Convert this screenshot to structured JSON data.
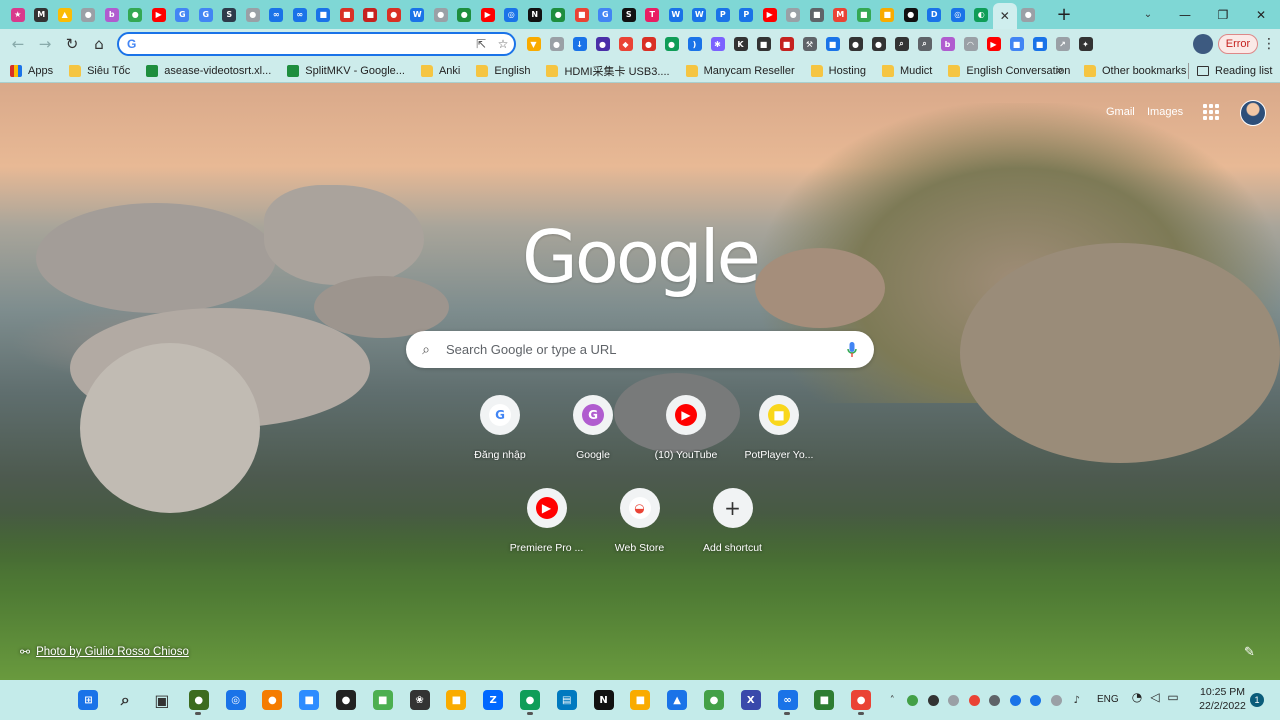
{
  "tabstrip": {
    "tabs": [
      {
        "icon": "ext-icon",
        "color": "#d93a8c",
        "glyph": "★"
      },
      {
        "icon": "site-icon",
        "color": "#333333",
        "glyph": "M"
      },
      {
        "icon": "drive-icon",
        "color": "#fbbc04",
        "glyph": "▲"
      },
      {
        "icon": "site-icon",
        "color": "#9aa0a6",
        "glyph": "●"
      },
      {
        "icon": "site-icon",
        "color": "#b05ccf",
        "glyph": "b"
      },
      {
        "icon": "site-icon",
        "color": "#34a853",
        "glyph": "●"
      },
      {
        "icon": "youtube-icon",
        "color": "#ff0000",
        "glyph": "▶"
      },
      {
        "icon": "google-icon",
        "color": "#4285f4",
        "glyph": "G"
      },
      {
        "icon": "google-icon",
        "color": "#4285f4",
        "glyph": "G"
      },
      {
        "icon": "site-icon",
        "color": "#2e3a4a",
        "glyph": "S"
      },
      {
        "icon": "site-icon",
        "color": "#9aa0a6",
        "glyph": "●"
      },
      {
        "icon": "site-icon",
        "color": "#1a73e8",
        "glyph": "∞"
      },
      {
        "icon": "site-icon",
        "color": "#1a73e8",
        "glyph": "∞"
      },
      {
        "icon": "site-icon",
        "color": "#1a73e8",
        "glyph": "■"
      },
      {
        "icon": "site-icon",
        "color": "#d93025",
        "glyph": "■"
      },
      {
        "icon": "site-icon",
        "color": "#c5221f",
        "glyph": "■"
      },
      {
        "icon": "site-icon",
        "color": "#d93025",
        "glyph": "●"
      },
      {
        "icon": "wordpress-icon",
        "color": "#1a73e8",
        "glyph": "W"
      },
      {
        "icon": "site-icon",
        "color": "#9aa0a6",
        "glyph": "●"
      },
      {
        "icon": "site-icon",
        "color": "#1e8e3e",
        "glyph": "●"
      },
      {
        "icon": "youtube-icon",
        "color": "#ff0000",
        "glyph": "▶"
      },
      {
        "icon": "site-icon",
        "color": "#1a73e8",
        "glyph": "◎"
      },
      {
        "icon": "notion-icon",
        "color": "#111111",
        "glyph": "N"
      },
      {
        "icon": "site-icon",
        "color": "#1e8e3e",
        "glyph": "●"
      },
      {
        "icon": "site-icon",
        "color": "#ea4335",
        "glyph": "■"
      },
      {
        "icon": "google-icon",
        "color": "#4285f4",
        "glyph": "G"
      },
      {
        "icon": "site-icon",
        "color": "#111111",
        "glyph": "S"
      },
      {
        "icon": "site-icon",
        "color": "#e91e63",
        "glyph": "T"
      },
      {
        "icon": "wordpress-icon",
        "color": "#1a73e8",
        "glyph": "W"
      },
      {
        "icon": "wordpress-icon",
        "color": "#1a73e8",
        "glyph": "W"
      },
      {
        "icon": "site-icon",
        "color": "#1a73e8",
        "glyph": "P"
      },
      {
        "icon": "site-icon",
        "color": "#1a73e8",
        "glyph": "P"
      },
      {
        "icon": "youtube-icon",
        "color": "#ff0000",
        "glyph": "▶"
      },
      {
        "icon": "site-icon",
        "color": "#9aa0a6",
        "glyph": "●"
      },
      {
        "icon": "site-icon",
        "color": "#5f6368",
        "glyph": "■"
      },
      {
        "icon": "gmail-icon",
        "color": "#ea4335",
        "glyph": "M"
      },
      {
        "icon": "site-icon",
        "color": "#34a853",
        "glyph": "■"
      },
      {
        "icon": "site-icon",
        "color": "#f9ab00",
        "glyph": "■"
      },
      {
        "icon": "site-icon",
        "color": "#111111",
        "glyph": "●"
      },
      {
        "icon": "site-icon",
        "color": "#1a73e8",
        "glyph": "D"
      },
      {
        "icon": "site-icon",
        "color": "#1a73e8",
        "glyph": "◎"
      },
      {
        "icon": "site-icon",
        "color": "#0f9d58",
        "glyph": "◐"
      }
    ],
    "active_tab_close": "✕",
    "after_active": {
      "icon": "site-icon",
      "color": "#9aa0a6",
      "glyph": "●"
    },
    "new_tab": "+",
    "tab_search": "⌄",
    "window_controls": {
      "minimize": "—",
      "maximize": "❐",
      "close": "✕"
    }
  },
  "toolbar": {
    "back": "←",
    "forward": "→",
    "reload": "↻",
    "home": "⌂",
    "omnibox_g": "G",
    "omnibox_value": "",
    "share": "⇱",
    "star": "☆",
    "extensions": [
      {
        "icon": "ext-icon",
        "color": "#f9ab00",
        "glyph": "▼"
      },
      {
        "icon": "ext-icon",
        "color": "#9aa0a6",
        "glyph": "●"
      },
      {
        "icon": "ext-icon",
        "color": "#1a73e8",
        "glyph": "↓"
      },
      {
        "icon": "ext-icon",
        "color": "#4a2fa8",
        "glyph": "●"
      },
      {
        "icon": "ext-icon",
        "color": "#ea4335",
        "glyph": "◆"
      },
      {
        "icon": "ext-icon",
        "color": "#d93025",
        "glyph": "●"
      },
      {
        "icon": "ext-icon",
        "color": "#0f9d58",
        "glyph": "●"
      },
      {
        "icon": "ext-icon",
        "color": "#1a73e8",
        "glyph": ")"
      },
      {
        "icon": "ext-icon",
        "color": "#7b61ff",
        "glyph": "✱"
      },
      {
        "icon": "ext-icon",
        "color": "#333333",
        "glyph": "K"
      },
      {
        "icon": "ext-icon",
        "color": "#333333",
        "glyph": "■"
      },
      {
        "icon": "ext-icon",
        "color": "#c5221f",
        "glyph": "■"
      },
      {
        "icon": "ext-icon",
        "color": "#5f6368",
        "glyph": "⚒"
      },
      {
        "icon": "ext-icon",
        "color": "#1a73e8",
        "glyph": "■"
      },
      {
        "icon": "ext-icon",
        "color": "#333333",
        "glyph": "●"
      },
      {
        "icon": "ext-icon",
        "color": "#333333",
        "glyph": "●"
      },
      {
        "icon": "ext-icon",
        "color": "#333333",
        "glyph": "⌕"
      },
      {
        "icon": "ext-icon",
        "color": "#5f6368",
        "glyph": "⌕"
      },
      {
        "icon": "ext-icon",
        "color": "#b05ccf",
        "glyph": "b"
      },
      {
        "icon": "ext-icon",
        "color": "#9aa0a6",
        "glyph": "◠"
      },
      {
        "icon": "ext-icon",
        "color": "#ff0000",
        "glyph": "▶"
      },
      {
        "icon": "ext-icon",
        "color": "#4285f4",
        "glyph": "■"
      },
      {
        "icon": "ext-icon",
        "color": "#1a73e8",
        "glyph": "■"
      },
      {
        "icon": "ext-icon",
        "color": "#9aa0a6",
        "glyph": "↗"
      },
      {
        "icon": "puzzle-icon",
        "color": "#333333",
        "glyph": "✦"
      }
    ],
    "error_label": "Error",
    "menu": "⋮"
  },
  "bookmarks": {
    "items": [
      {
        "label": "Apps",
        "type": "grid"
      },
      {
        "label": "Siêu Tốc",
        "type": "folder"
      },
      {
        "label": "asease-videotosrt.xl...",
        "type": "sheet"
      },
      {
        "label": "SplitMKV - Google...",
        "type": "sheet"
      },
      {
        "label": "Anki",
        "type": "folder"
      },
      {
        "label": "English",
        "type": "folder"
      },
      {
        "label": "HDMI采集卡 USB3....",
        "type": "folder"
      },
      {
        "label": "Manycam Reseller",
        "type": "folder"
      },
      {
        "label": "Hosting",
        "type": "folder"
      },
      {
        "label": "Mudict",
        "type": "folder"
      },
      {
        "label": "English Conversation",
        "type": "folder"
      }
    ],
    "more": "»",
    "other_bookmarks": "Other bookmarks",
    "reading_list": "Reading list"
  },
  "ntp": {
    "gmail": "Gmail",
    "images": "Images",
    "logo": "Google",
    "search_placeholder": "Search Google or type a URL",
    "shortcuts": [
      {
        "label": "Đăng nhập",
        "glyph": "G",
        "bg": "#ffffff",
        "fg": "#4285f4"
      },
      {
        "label": "Google",
        "glyph": "G",
        "bg": "#b05ccf",
        "fg": "#ffffff"
      },
      {
        "label": "(10) YouTube",
        "glyph": "▶",
        "bg": "#ff0000",
        "fg": "#ffffff"
      },
      {
        "label": "PotPlayer Yo...",
        "glyph": "■",
        "bg": "#f9d71c",
        "fg": "#ffffff"
      },
      {
        "label": "Premiere Pro ...",
        "glyph": "▶",
        "bg": "#ff0000",
        "fg": "#ffffff"
      },
      {
        "label": "Web Store",
        "glyph": "◒",
        "bg": "#ffffff",
        "fg": "#ea4335"
      },
      {
        "label": "Add shortcut",
        "glyph": "+",
        "bg": "#f1f3f4",
        "fg": "#333333"
      }
    ],
    "photo_credit": "Photo by Giulio Rosso Chioso",
    "customize_icon": "✎"
  },
  "taskbar": {
    "apps": [
      {
        "icon": "windows-start-icon",
        "color": "#1a73e8",
        "glyph": "⊞",
        "running": false
      },
      {
        "icon": "search-icon",
        "color": "#333333",
        "glyph": "⌕",
        "running": false
      },
      {
        "icon": "task-view-icon",
        "color": "#333333",
        "glyph": "▣",
        "running": false
      },
      {
        "icon": "app-icon",
        "color": "#3d6b1f",
        "glyph": "●",
        "running": true
      },
      {
        "icon": "app-icon",
        "color": "#1a73e8",
        "glyph": "◎",
        "running": false
      },
      {
        "icon": "app-icon",
        "color": "#f57c00",
        "glyph": "●",
        "running": false
      },
      {
        "icon": "zoom-icon",
        "color": "#2d8cff",
        "glyph": "■",
        "running": false
      },
      {
        "icon": "app-icon",
        "color": "#222222",
        "glyph": "●",
        "running": false
      },
      {
        "icon": "app-icon",
        "color": "#4caf50",
        "glyph": "■",
        "running": false
      },
      {
        "icon": "app-icon",
        "color": "#333333",
        "glyph": "❀",
        "running": false
      },
      {
        "icon": "folder-icon",
        "color": "#f9ab00",
        "glyph": "■",
        "running": false
      },
      {
        "icon": "zalo-icon",
        "color": "#0068ff",
        "glyph": "Z",
        "running": false
      },
      {
        "icon": "app-icon",
        "color": "#0f9d58",
        "glyph": "●",
        "running": true
      },
      {
        "icon": "trello-icon",
        "color": "#0079bf",
        "glyph": "▤",
        "running": false
      },
      {
        "icon": "notion-icon",
        "color": "#111111",
        "glyph": "N",
        "running": false
      },
      {
        "icon": "app-icon",
        "color": "#f9ab00",
        "glyph": "■",
        "running": false
      },
      {
        "icon": "app-icon",
        "color": "#1a73e8",
        "glyph": "▲",
        "running": false
      },
      {
        "icon": "app-icon",
        "color": "#43a047",
        "glyph": "●",
        "running": false
      },
      {
        "icon": "app-icon",
        "color": "#3949ab",
        "glyph": "X",
        "running": false
      },
      {
        "icon": "app-icon",
        "color": "#1a73e8",
        "glyph": "∞",
        "running": true
      },
      {
        "icon": "app-icon",
        "color": "#2e7d32",
        "glyph": "■",
        "running": false
      },
      {
        "icon": "chrome-icon",
        "color": "#ea4335",
        "glyph": "●",
        "running": true
      }
    ],
    "tray": [
      {
        "icon": "chevron-up-icon",
        "glyph": "˄"
      },
      {
        "icon": "tray-icon",
        "color": "#43a047"
      },
      {
        "icon": "tray-icon",
        "color": "#333333"
      },
      {
        "icon": "tray-icon",
        "color": "#9aa0a6"
      },
      {
        "icon": "tray-icon",
        "color": "#ea4335"
      },
      {
        "icon": "tray-icon",
        "color": "#5f6368"
      },
      {
        "icon": "tray-icon",
        "color": "#1a73e8"
      },
      {
        "icon": "bluetooth-icon",
        "color": "#1a73e8"
      },
      {
        "icon": "tray-icon",
        "color": "#9aa0a6"
      },
      {
        "icon": "microphone-icon",
        "glyph": "♪"
      }
    ],
    "language": "ENG",
    "wifi": "◔",
    "volume": "◁",
    "battery": "▭",
    "time": "10:25 PM",
    "date": "22/2/2022",
    "notifications": "1"
  }
}
